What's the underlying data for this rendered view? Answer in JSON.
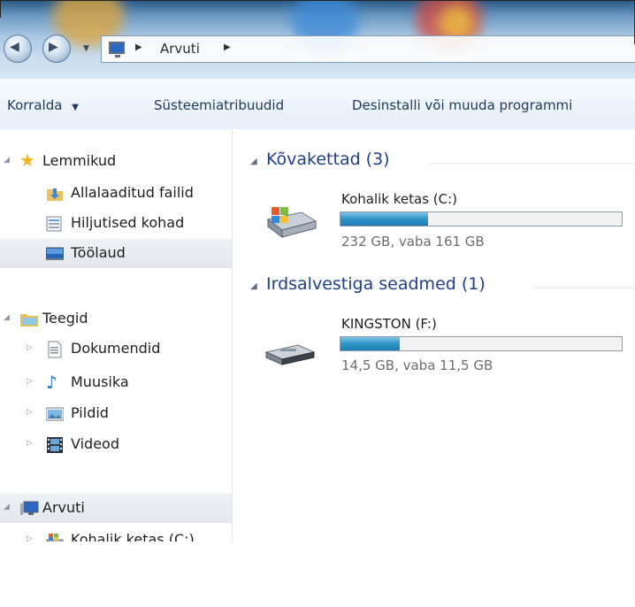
{
  "address_bar": {
    "location": "Arvuti"
  },
  "toolbar": {
    "organize": "Korralda",
    "system_properties": "Süsteemiatribuudid",
    "uninstall": "Desinstalli või muuda programmi"
  },
  "sidebar": {
    "favorites": {
      "label": "Lemmikud",
      "items": [
        {
          "label": "Allalaaditud failid",
          "icon": "downloads-folder-icon"
        },
        {
          "label": "Hiljutised kohad",
          "icon": "recent-places-icon"
        },
        {
          "label": "Töölaud",
          "icon": "desktop-icon"
        }
      ]
    },
    "libraries": {
      "label": "Teegid",
      "items": [
        {
          "label": "Dokumendid",
          "icon": "document-icon"
        },
        {
          "label": "Muusika",
          "icon": "music-note-icon"
        },
        {
          "label": "Pildid",
          "icon": "picture-icon"
        },
        {
          "label": "Videod",
          "icon": "film-icon"
        }
      ]
    },
    "computer": {
      "label": "Arvuti",
      "items": [
        {
          "label": "Kohalik ketas (C:)",
          "icon": "windows-drive-icon"
        }
      ]
    }
  },
  "content": {
    "hard_drives": {
      "title": "Kõvakettad (3)",
      "drives": [
        {
          "name": "Kohalik ketas (C:)",
          "info": "232 GB, vaba 161 GB",
          "used_fraction": 0.31
        }
      ]
    },
    "removable": {
      "title": "Irdsalvestiga seadmed (1)",
      "drives": [
        {
          "name": "KINGSTON (F:)",
          "info": "14,5 GB, vaba 11,5 GB",
          "used_fraction": 0.21
        }
      ]
    }
  },
  "colors": {
    "group_title": "#1e3f8a",
    "bar_fill": "#2f95c6",
    "toolbar_text": "#1e395b"
  }
}
